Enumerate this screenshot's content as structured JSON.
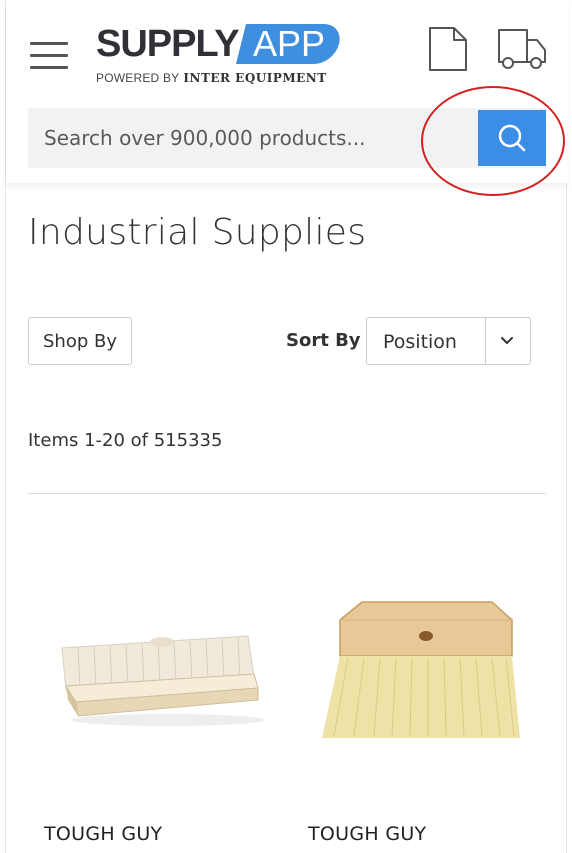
{
  "header": {
    "menu_icon": "hamburger-menu-icon",
    "logo": {
      "word1": "SUPPLY",
      "word2": "APP",
      "powered_by": "POWERED BY",
      "company": "INTER EQUIPMENT"
    },
    "quote_icon": "document-icon",
    "cart_icon": "truck-icon"
  },
  "search": {
    "placeholder": "Search over 900,000 products...",
    "value": "",
    "button_icon": "search-icon"
  },
  "page": {
    "title": "Industrial Supplies"
  },
  "toolbar": {
    "shop_by_label": "Shop By",
    "sort_label": "Sort By",
    "sort_value": "Position",
    "sort_icon": "chevron-down-icon"
  },
  "results": {
    "count_text": "Items 1-20 of 515335"
  },
  "products": [
    {
      "name": "TOUGH GUY",
      "image": "scrub-brush"
    },
    {
      "name": "TOUGH GUY",
      "image": "tampico-brush"
    }
  ],
  "colors": {
    "accent": "#3a8ee6",
    "annotation": "#d42020"
  }
}
